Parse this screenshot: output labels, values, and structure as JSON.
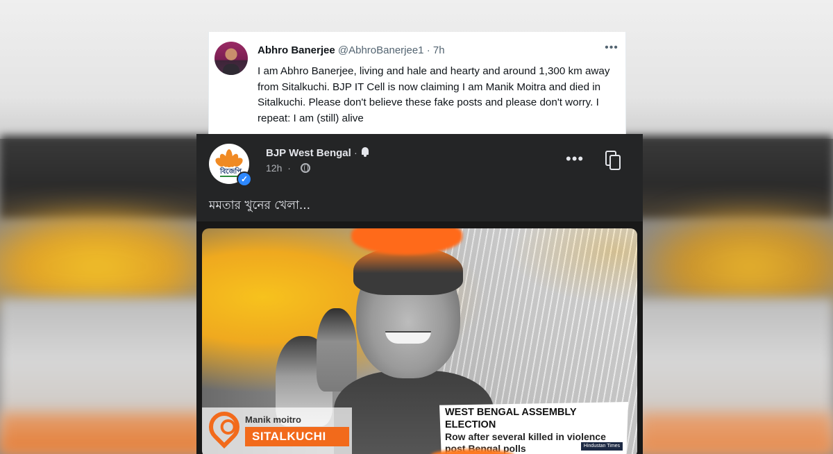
{
  "tweet": {
    "author_name": "Abhro Banerjee",
    "handle": "@AbhroBanerjee1",
    "separator": "·",
    "time": "7h",
    "more_label": "•••",
    "text": "I am Abhro Banerjee, living and hale and hearty and around 1,300 km away from Sitalkuchi. BJP IT Cell is now claiming I am Manik Moitra and died in Sitalkuchi. Please don't believe these fake posts and please don't worry. I repeat: I am (still) alive"
  },
  "facebook_post": {
    "page_name": "BJP West Bengal",
    "separator": "·",
    "time": "12h",
    "logo_text": "বিজেপি",
    "more_label": "•••",
    "caption": "মমতার খুনের খেলা...",
    "poster": {
      "location_person": "Manik moitro",
      "location_place": "SITALKUCHI",
      "headline": "WEST BENGAL ASSEMBLY ELECTION",
      "subheadline": "Row after several killed in violence post Bengal polls",
      "source_logo": "Hindustan Times"
    }
  }
}
